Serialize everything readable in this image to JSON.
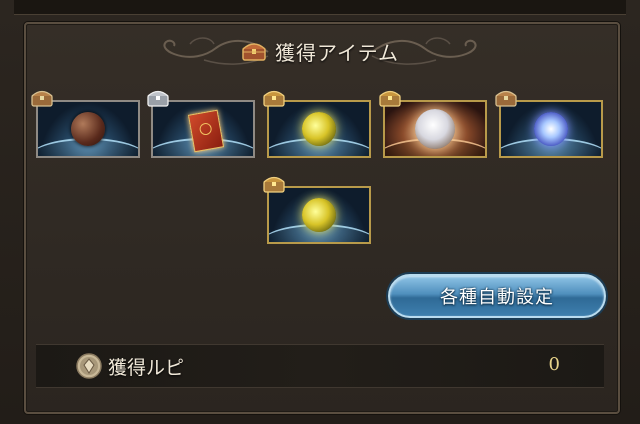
{
  "header": {
    "title": "獲得アイテム",
    "icon": "treasure-chest-icon"
  },
  "items": [
    {
      "name": "brown-orb-item",
      "chest": "wooden-chest",
      "style": "brown"
    },
    {
      "name": "red-book-item",
      "chest": "silver-chest",
      "style": "book"
    },
    {
      "name": "gold-orb-item",
      "chest": "gold-chest",
      "style": "gold"
    },
    {
      "name": "white-orb-item",
      "chest": "gold-chest",
      "style": "white"
    },
    {
      "name": "blue-orb-item",
      "chest": "wooden-chest",
      "style": "blue"
    },
    {
      "name": "gold-orb-item",
      "chest": "gold-chest",
      "style": "gold"
    }
  ],
  "actions": {
    "auto_settings_label": "各種自動設定"
  },
  "rupie": {
    "label": "獲得ルピ",
    "value": "0",
    "icon": "rupie-coin-icon"
  },
  "colors": {
    "panel_bg": "#2f2923",
    "panel_border": "#5a4e40",
    "button_blue": "#4f8fbd",
    "rupie_value": "#e8d48a"
  }
}
